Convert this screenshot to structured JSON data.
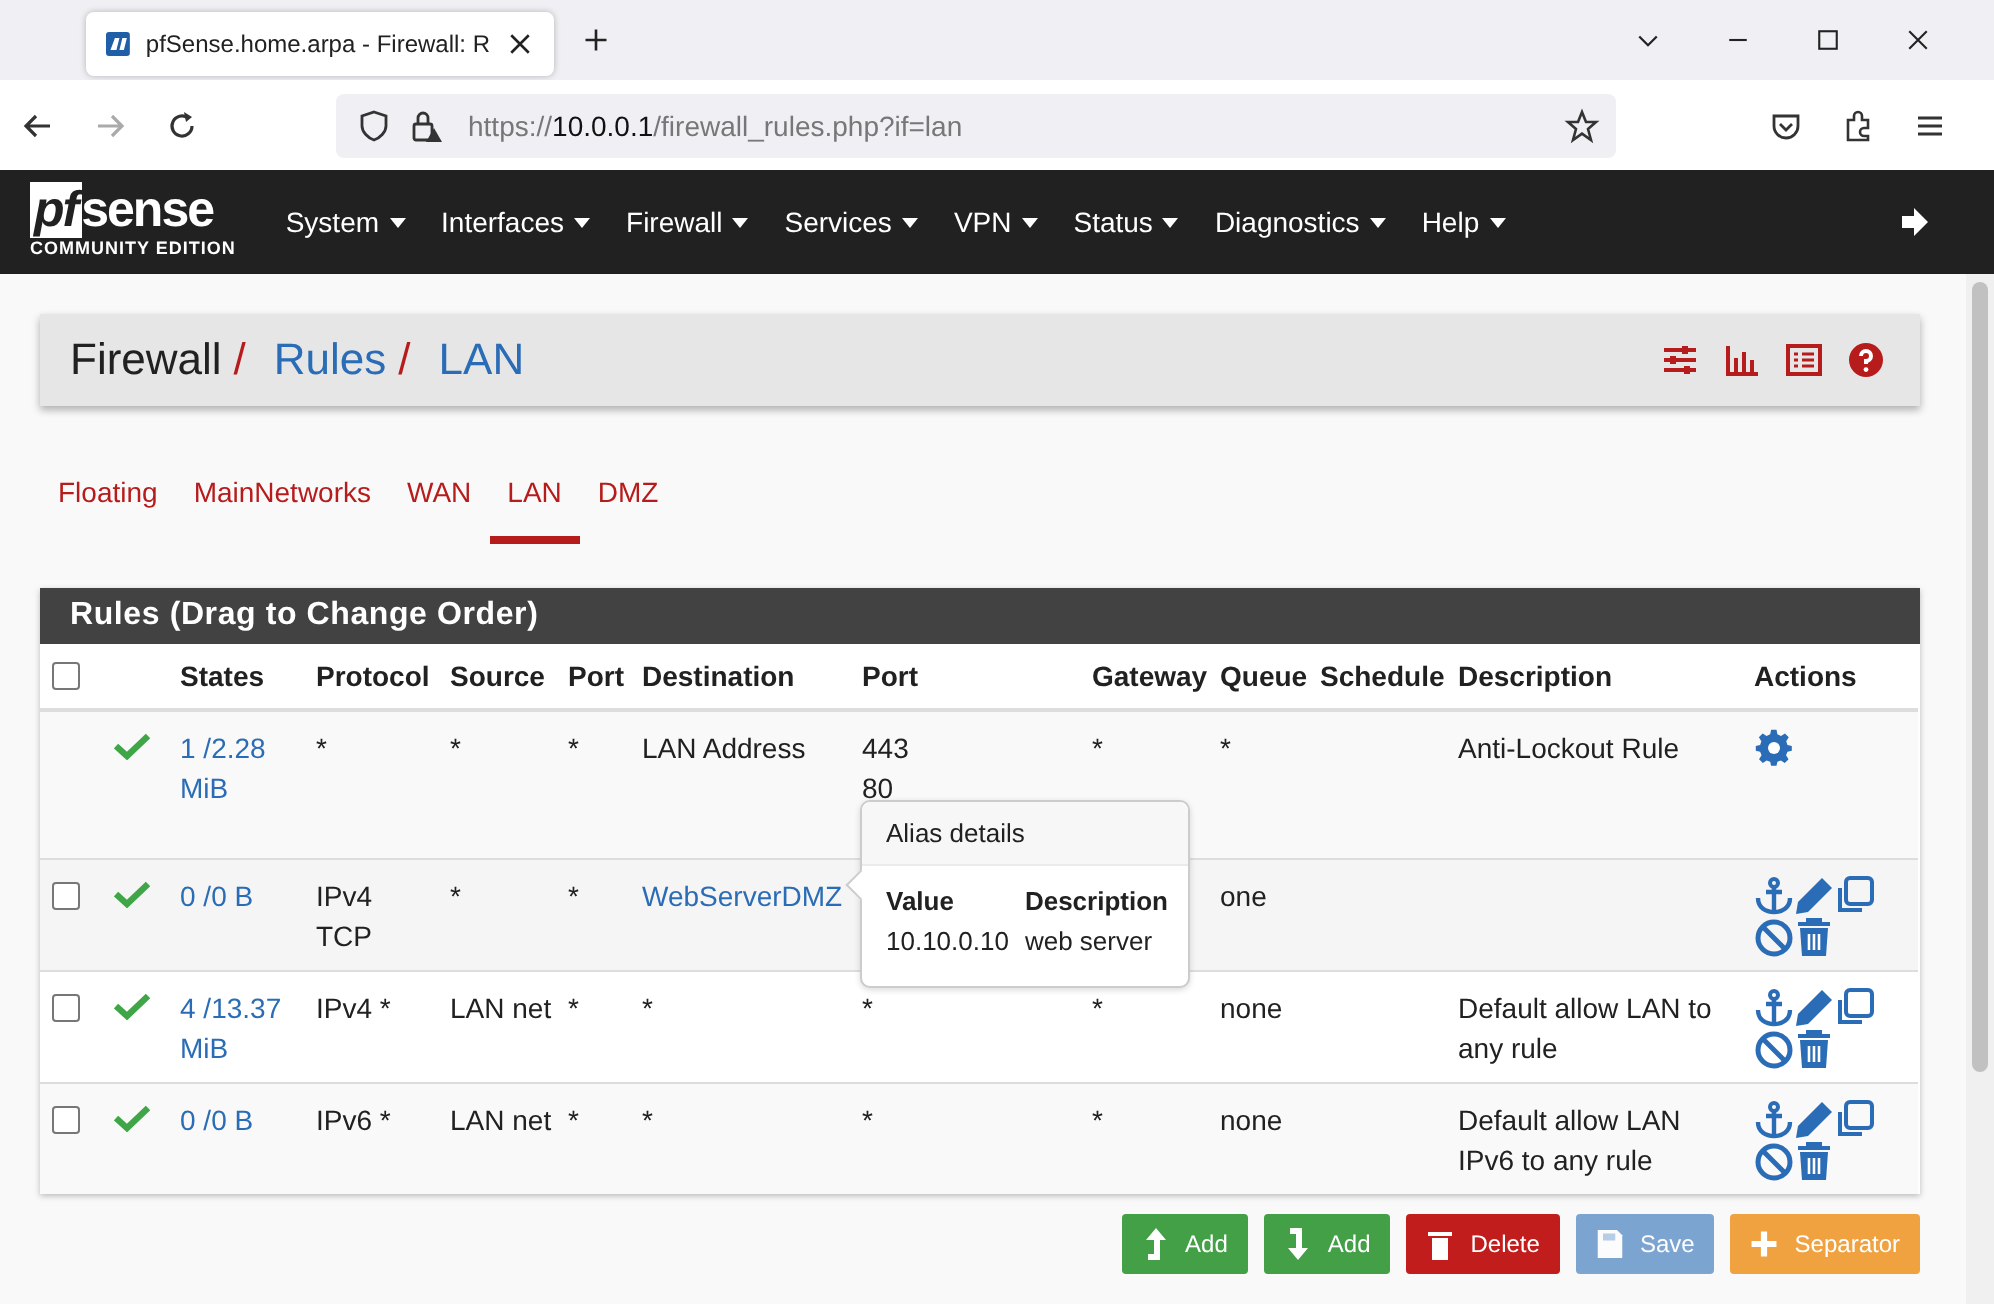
{
  "browser": {
    "tab_title": "pfSense.home.arpa - Firewall: R",
    "url_prefix": "https://",
    "url_host": "10.0.0.1",
    "url_path": "/firewall_rules.php?if=lan"
  },
  "nav": {
    "logo_prefix": "pf",
    "logo_name": "sense",
    "logo_subtitle": "COMMUNITY EDITION",
    "menu": [
      "System",
      "Interfaces",
      "Firewall",
      "Services",
      "VPN",
      "Status",
      "Diagnostics",
      "Help"
    ]
  },
  "breadcrumb": [
    "Firewall",
    "Rules",
    "LAN"
  ],
  "breadcrumb_separator": "/",
  "tabs": [
    {
      "label": "Floating",
      "selected": false
    },
    {
      "label": "MainNetworks",
      "selected": false
    },
    {
      "label": "WAN",
      "selected": false
    },
    {
      "label": "LAN",
      "selected": true
    },
    {
      "label": "DMZ",
      "selected": false
    }
  ],
  "panel": {
    "title": "Rules (Drag to Change Order)",
    "select_all_checked": false,
    "columns": [
      "States",
      "Protocol",
      "Source",
      "Port",
      "Destination",
      "Port",
      "Gateway",
      "Queue",
      "Schedule",
      "Description",
      "Actions"
    ],
    "rows": [
      {
        "kind": "locked",
        "enabled": true,
        "states": "1 /2.28 MiB",
        "protocol": "*",
        "source": "*",
        "source_port": "*",
        "destination": "LAN Address",
        "destination_link": false,
        "dest_port": "443\n80",
        "gateway": "*",
        "queue": "*",
        "schedule": "",
        "description": "Anti-Lockout Rule"
      },
      {
        "kind": "rule",
        "checked": false,
        "enabled": true,
        "states": "0 /0 B",
        "protocol": "IPv4\nTCP",
        "source": "*",
        "source_port": "*",
        "destination": "WebServerDMZ",
        "destination_link": true,
        "dest_port": "",
        "gateway": "",
        "queue": "one",
        "schedule": "",
        "description": ""
      },
      {
        "kind": "rule",
        "checked": false,
        "enabled": true,
        "states": "4 /13.37 MiB",
        "protocol": "IPv4 *",
        "source": "LAN net",
        "source_port": "*",
        "destination": "*",
        "destination_link": false,
        "dest_port": "*",
        "gateway": "*",
        "queue": "none",
        "schedule": "",
        "description": "Default allow LAN to any rule"
      },
      {
        "kind": "rule",
        "checked": false,
        "enabled": true,
        "states": "0 /0 B",
        "protocol": "IPv6 *",
        "source": "LAN net",
        "source_port": "*",
        "destination": "*",
        "destination_link": false,
        "dest_port": "*",
        "gateway": "*",
        "queue": "none",
        "schedule": "",
        "description": "Default allow LAN IPv6 to any rule"
      }
    ]
  },
  "popover": {
    "title": "Alias details",
    "columns": [
      "Value",
      "Description"
    ],
    "cells": [
      "10.10.0.10",
      "web server"
    ]
  },
  "buttons": [
    {
      "kind": "add-top",
      "label": "Add",
      "disabled": false
    },
    {
      "kind": "add-bottom",
      "label": "Add",
      "disabled": false
    },
    {
      "kind": "delete",
      "label": "Delete",
      "disabled": false
    },
    {
      "kind": "save",
      "label": "Save",
      "disabled": true
    },
    {
      "kind": "separator",
      "label": "Separator",
      "disabled": false
    }
  ]
}
